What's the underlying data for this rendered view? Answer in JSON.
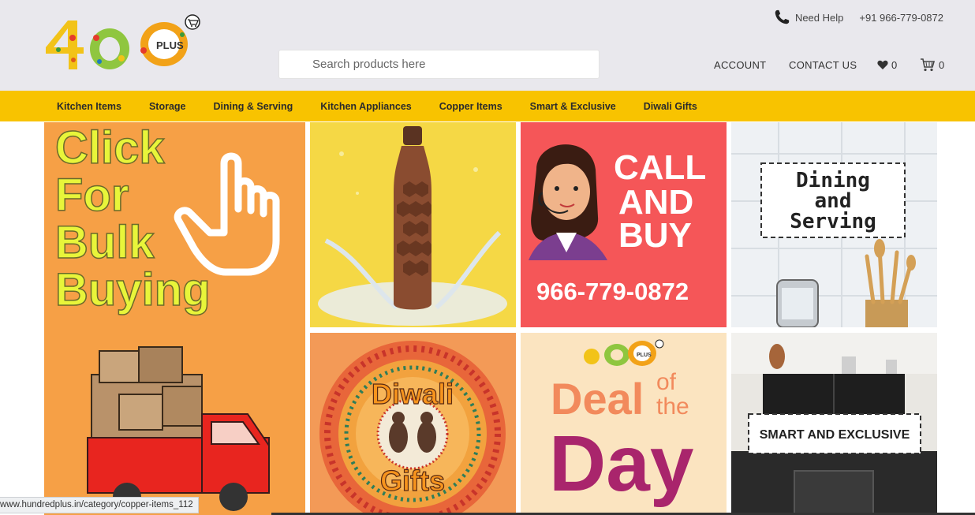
{
  "header": {
    "logo_text": "100 PLUS",
    "help_label": "Need Help",
    "help_phone": "+91 966-779-0872",
    "search_placeholder": "Search products here",
    "account_label": "ACCOUNT",
    "contact_label": "CONTACT US",
    "wishlist_count": "0",
    "cart_count": "0"
  },
  "categories": [
    "Kitchen Items",
    "Storage",
    "Dining & Serving",
    "Kitchen Appliances",
    "Copper Items",
    "Smart & Exclusive",
    "Diwali Gifts"
  ],
  "tiles": {
    "bulk": {
      "lines": [
        "Click",
        "For",
        "Bulk",
        "Buying"
      ]
    },
    "call": {
      "line1": "CALL",
      "line2": "AND",
      "line3": "BUY",
      "phone": "966-779-0872"
    },
    "dining": {
      "line1": "Dining",
      "line2": "and",
      "line3": "Serving"
    },
    "diwali": {
      "line1": "Diwali",
      "line2": "Gifts"
    },
    "deal": {
      "word1": "Deal",
      "word2": "of",
      "word3": "the",
      "word4": "Day"
    },
    "smart": {
      "label": "SMART AND EXCLUSIVE"
    }
  },
  "status_url": "www.hundredplus.in/category/copper-items_112",
  "colors": {
    "header_bg": "#e9e8ed",
    "category_bar": "#f8c300",
    "bulk_tile": "#f6a046",
    "call_tile": "#f55658",
    "accent_yellow": "#e8f53a"
  }
}
